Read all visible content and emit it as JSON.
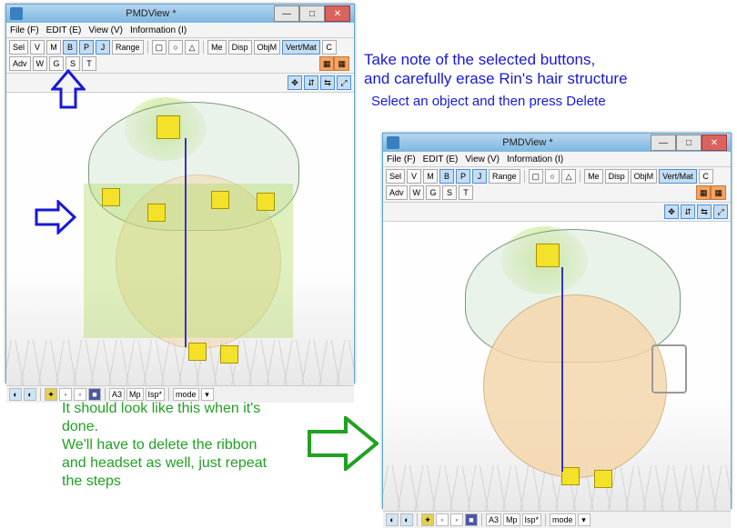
{
  "window1": {
    "title": "PMDView *",
    "menu": {
      "file": "File (F)",
      "edit": "EDIT (E)",
      "view": "View (V)",
      "info": "Information (I)"
    },
    "toolbar": {
      "sel": "Sel",
      "v": "V",
      "m": "M",
      "b": "B",
      "p": "P",
      "j": "J",
      "range": "Range",
      "me": "Me",
      "disp": "Disp",
      "objm": "ObjM",
      "vertmat": "Vert/Mat",
      "c": "C",
      "adv": "Adv",
      "w": "W",
      "g": "G",
      "s": "S",
      "t": "T"
    },
    "status": {
      "a3": "A3",
      "mp0": "Mp",
      "isp": "Isp*",
      "mode": "mode"
    }
  },
  "window2": {
    "title": "PMDView *",
    "menu": {
      "file": "File (F)",
      "edit": "EDIT (E)",
      "view": "View (V)",
      "info": "Information (I)"
    },
    "toolbar": {
      "sel": "Sel",
      "v": "V",
      "m": "M",
      "b": "B",
      "p": "P",
      "j": "J",
      "range": "Range",
      "me": "Me",
      "disp": "Disp",
      "objm": "ObjM",
      "vertmat": "Vert/Mat",
      "c": "C",
      "adv": "Adv",
      "w": "W",
      "g": "G",
      "s": "S",
      "t": "T"
    },
    "status": {
      "a3": "A3",
      "mp0": "Mp",
      "isp": "Isp*",
      "mode": "mode"
    }
  },
  "annot": {
    "line1": "Take note of the selected buttons,",
    "line2": "and carefully erase Rin's hair structure",
    "line3": "Select an object and then press Delete",
    "g1": "It should look like this when it's",
    "g2": "done.",
    "g3": "We'll have to delete the ribbon",
    "g4": "and headset as well, just repeat",
    "g5": "the steps"
  }
}
